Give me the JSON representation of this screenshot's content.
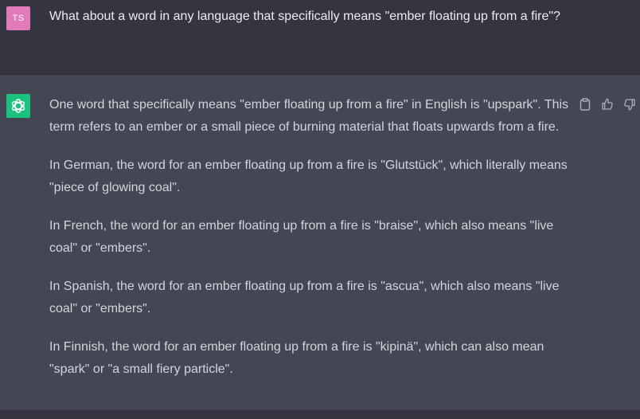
{
  "colors": {
    "user_avatar_bg": "#e17ab7",
    "gpt_avatar_bg": "#19c37d",
    "icon_color": "#acacbe"
  },
  "user_message": {
    "avatar_initials": "TS",
    "text": "What about a word in any language that specifically means \"ember floating up from a fire\"?"
  },
  "assistant_message": {
    "avatar_icon": "openai-logo-icon",
    "paragraphs": [
      "One word that specifically means \"ember floating up from a fire\" in English is \"upspark\". This term refers to an ember or a small piece of burning material that floats upwards from a fire.",
      "In German, the word for an ember floating up from a fire is \"Glutstück\", which literally means \"piece of glowing coal\".",
      "In French, the word for an ember floating up from a fire is \"braise\", which also means \"live coal\" or \"embers\".",
      "In Spanish, the word for an ember floating up from a fire is \"ascua\", which also means \"live coal\" or \"embers\".",
      "In Finnish, the word for an ember floating up from a fire is \"kipinä\", which can also mean \"spark\" or \"a small fiery particle\"."
    ],
    "actions": [
      "clipboard-icon",
      "thumbs-up-icon",
      "thumbs-down-icon"
    ]
  }
}
